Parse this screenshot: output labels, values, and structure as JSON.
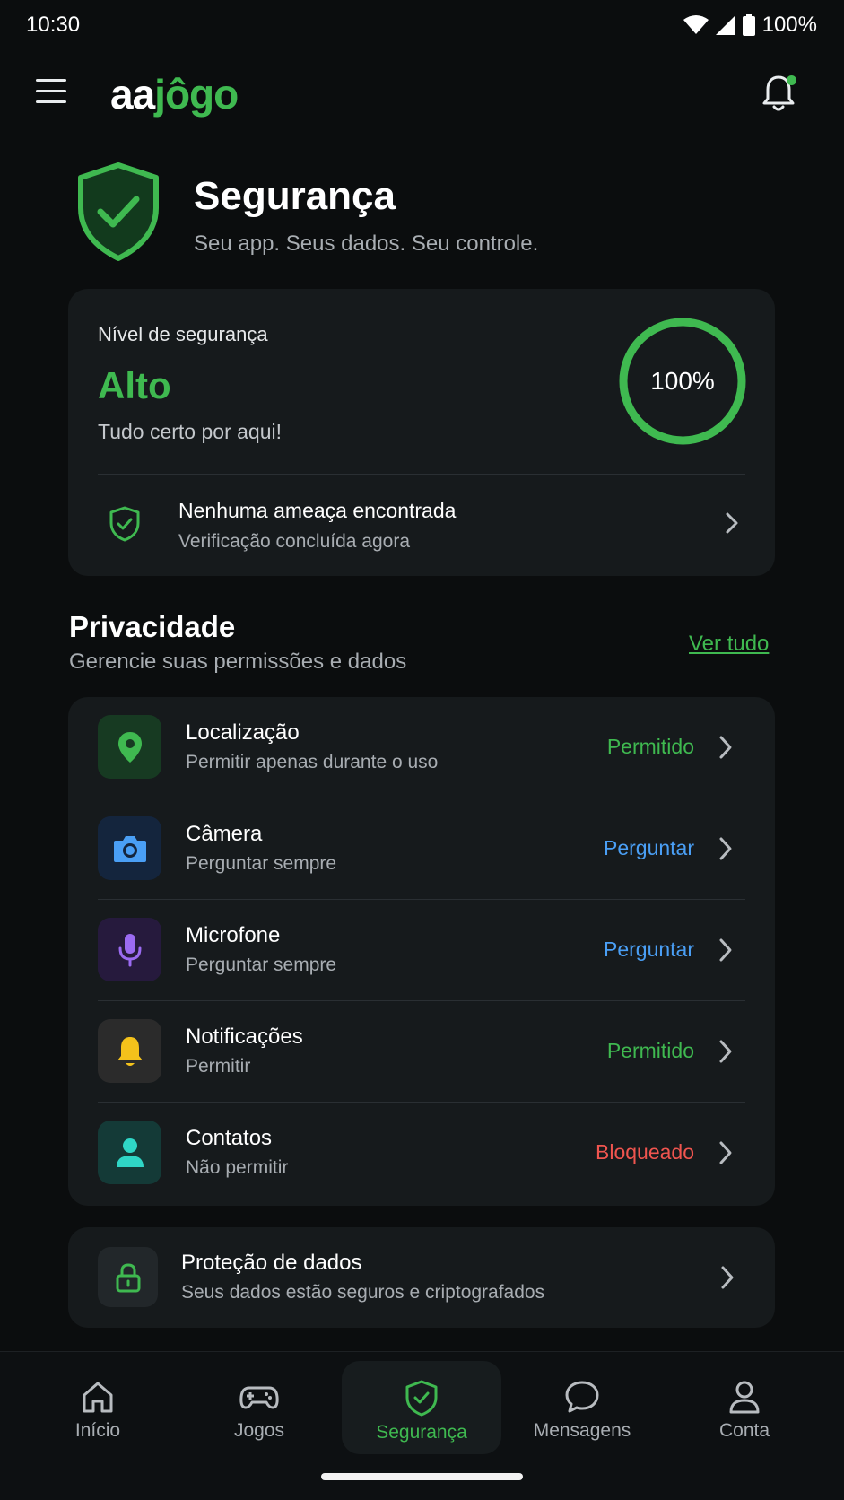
{
  "status_bar": {
    "time": "10:30",
    "battery": "100%"
  },
  "header": {
    "logo_part1": "aa",
    "logo_part2": "jôgo"
  },
  "page": {
    "title": "Segurança",
    "subtitle": "Seu app. Seus dados. Seu controle."
  },
  "security": {
    "label": "Nível de segurança",
    "level": "Alto",
    "description": "Tudo certo por aqui!",
    "percent_text": "100%",
    "percent": 100,
    "threat_title": "Nenhuma ameaça encontrada",
    "threat_sub": "Verificação concluída agora"
  },
  "privacy": {
    "title": "Privacidade",
    "subtitle": "Gerencie suas permissões e dados",
    "see_all": "Ver tudo",
    "items": [
      {
        "title": "Localização",
        "sub": "Permitir apenas durante o uso",
        "status": "Permitido",
        "icon": "location-pin-icon"
      },
      {
        "title": "Câmera",
        "sub": "Perguntar sempre",
        "status": "Perguntar",
        "icon": "camera-icon"
      },
      {
        "title": "Microfone",
        "sub": "Perguntar sempre",
        "status": "Perguntar",
        "icon": "microphone-icon"
      },
      {
        "title": "Notificações",
        "sub": "Permitir",
        "status": "Permitido",
        "icon": "bell-icon"
      },
      {
        "title": "Contatos",
        "sub": "Não permitir",
        "status": "Bloqueado",
        "icon": "person-icon"
      }
    ]
  },
  "data_protection": {
    "title": "Proteção de dados",
    "sub": "Seus dados estão seguros e criptografados"
  },
  "nav": {
    "items": [
      {
        "label": "Início",
        "icon": "home-icon"
      },
      {
        "label": "Jogos",
        "icon": "gamepad-icon"
      },
      {
        "label": "Segurança",
        "icon": "shield-check-icon"
      },
      {
        "label": "Mensagens",
        "icon": "chat-bubble-icon"
      },
      {
        "label": "Conta",
        "icon": "user-icon"
      }
    ],
    "active": "Segurança"
  },
  "colors": {
    "accent_green": "#3fb950",
    "ask_blue": "#4a9ff5",
    "blocked_red": "#f0554f",
    "background": "#0b0d0e",
    "card": "#161a1c"
  }
}
